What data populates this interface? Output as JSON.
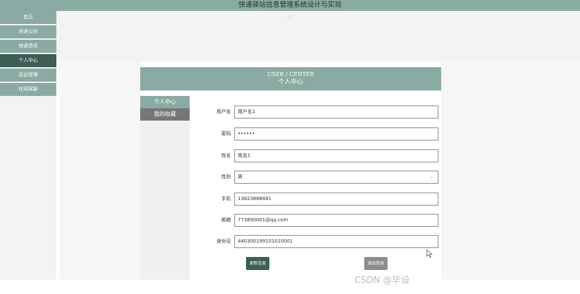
{
  "app_title": "快递驿站信息管理系统设计与实现",
  "nav": {
    "items": [
      {
        "label": "首页"
      },
      {
        "label": "快递公司"
      },
      {
        "label": "快递资讯"
      },
      {
        "label": "个人中心",
        "active": true
      },
      {
        "label": "后台管理"
      },
      {
        "label": "在线客服"
      }
    ]
  },
  "center": {
    "header_en": "USER / CENTER",
    "header_cn": "个人中心"
  },
  "side_panel": {
    "personal_center": "个人中心",
    "favorites": "我的收藏"
  },
  "form": {
    "username_label": "用户名",
    "username_value": "用户名1",
    "password_label": "密码",
    "password_value": "••••••",
    "name_label": "姓名",
    "name_value": "姓名1",
    "gender_label": "性别",
    "gender_value": "男",
    "phone_label": "手机",
    "phone_value": "13823888881",
    "email_label": "邮箱",
    "email_value": "773890001@qq.com",
    "idcard_label": "身份证",
    "idcard_value": "440300199101010001"
  },
  "buttons": {
    "update": "更新信息",
    "logout": "退出登录"
  },
  "watermark": "CSDN @毕设",
  "colors": {
    "accent": "#8aaba3",
    "accent_dark": "#3d5d55",
    "inactive": "#777777"
  }
}
